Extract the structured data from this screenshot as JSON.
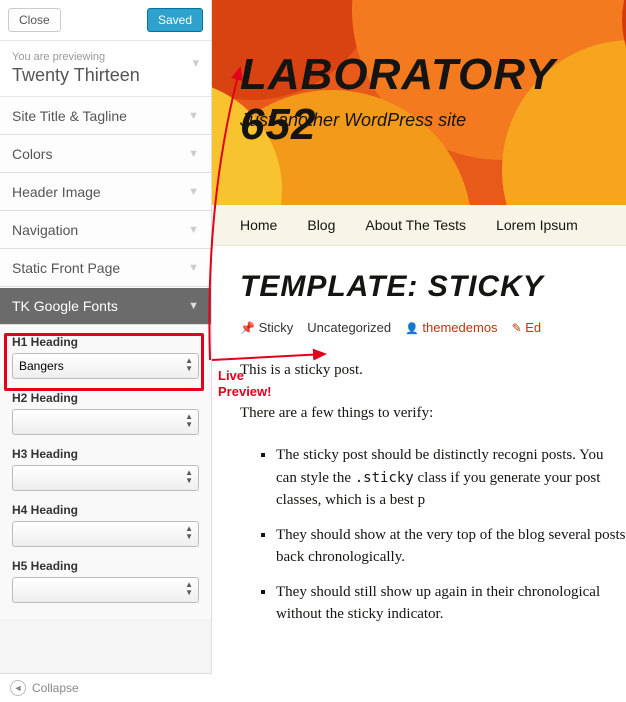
{
  "sidebar": {
    "close": "Close",
    "saved": "Saved",
    "previewing_label": "You are previewing",
    "theme": "Twenty Thirteen",
    "sections": [
      "Site Title & Tagline",
      "Colors",
      "Header Image",
      "Navigation",
      "Static Front Page"
    ],
    "active_section": "TK Google Fonts",
    "fields": [
      {
        "label": "H1 Heading",
        "value": "Bangers"
      },
      {
        "label": "H2 Heading",
        "value": ""
      },
      {
        "label": "H3 Heading",
        "value": ""
      },
      {
        "label": "H4 Heading",
        "value": ""
      },
      {
        "label": "H5 Heading",
        "value": ""
      }
    ],
    "collapse": "Collapse"
  },
  "preview": {
    "site_title": "Laboratory 652",
    "tagline": "Just another WordPress site",
    "nav": [
      "Home",
      "Blog",
      "About The Tests",
      "Lorem Ipsum"
    ],
    "post_title": "Template: Sticky",
    "meta": {
      "sticky": "Sticky",
      "category": "Uncategorized",
      "author": "themedemos",
      "edit": "Ed"
    },
    "p1": "This is a sticky post.",
    "p2": "There are a few things to verify:",
    "list": [
      "The sticky post should be distinctly recognizable posts. You can style the .sticky class if you generate your post classes, which is a best practice",
      "They should show at the very top of the blog several posts back chronologically.",
      "They should still show up again in their chronological without the sticky indicator."
    ]
  },
  "annotation": "Live\nPreview!"
}
